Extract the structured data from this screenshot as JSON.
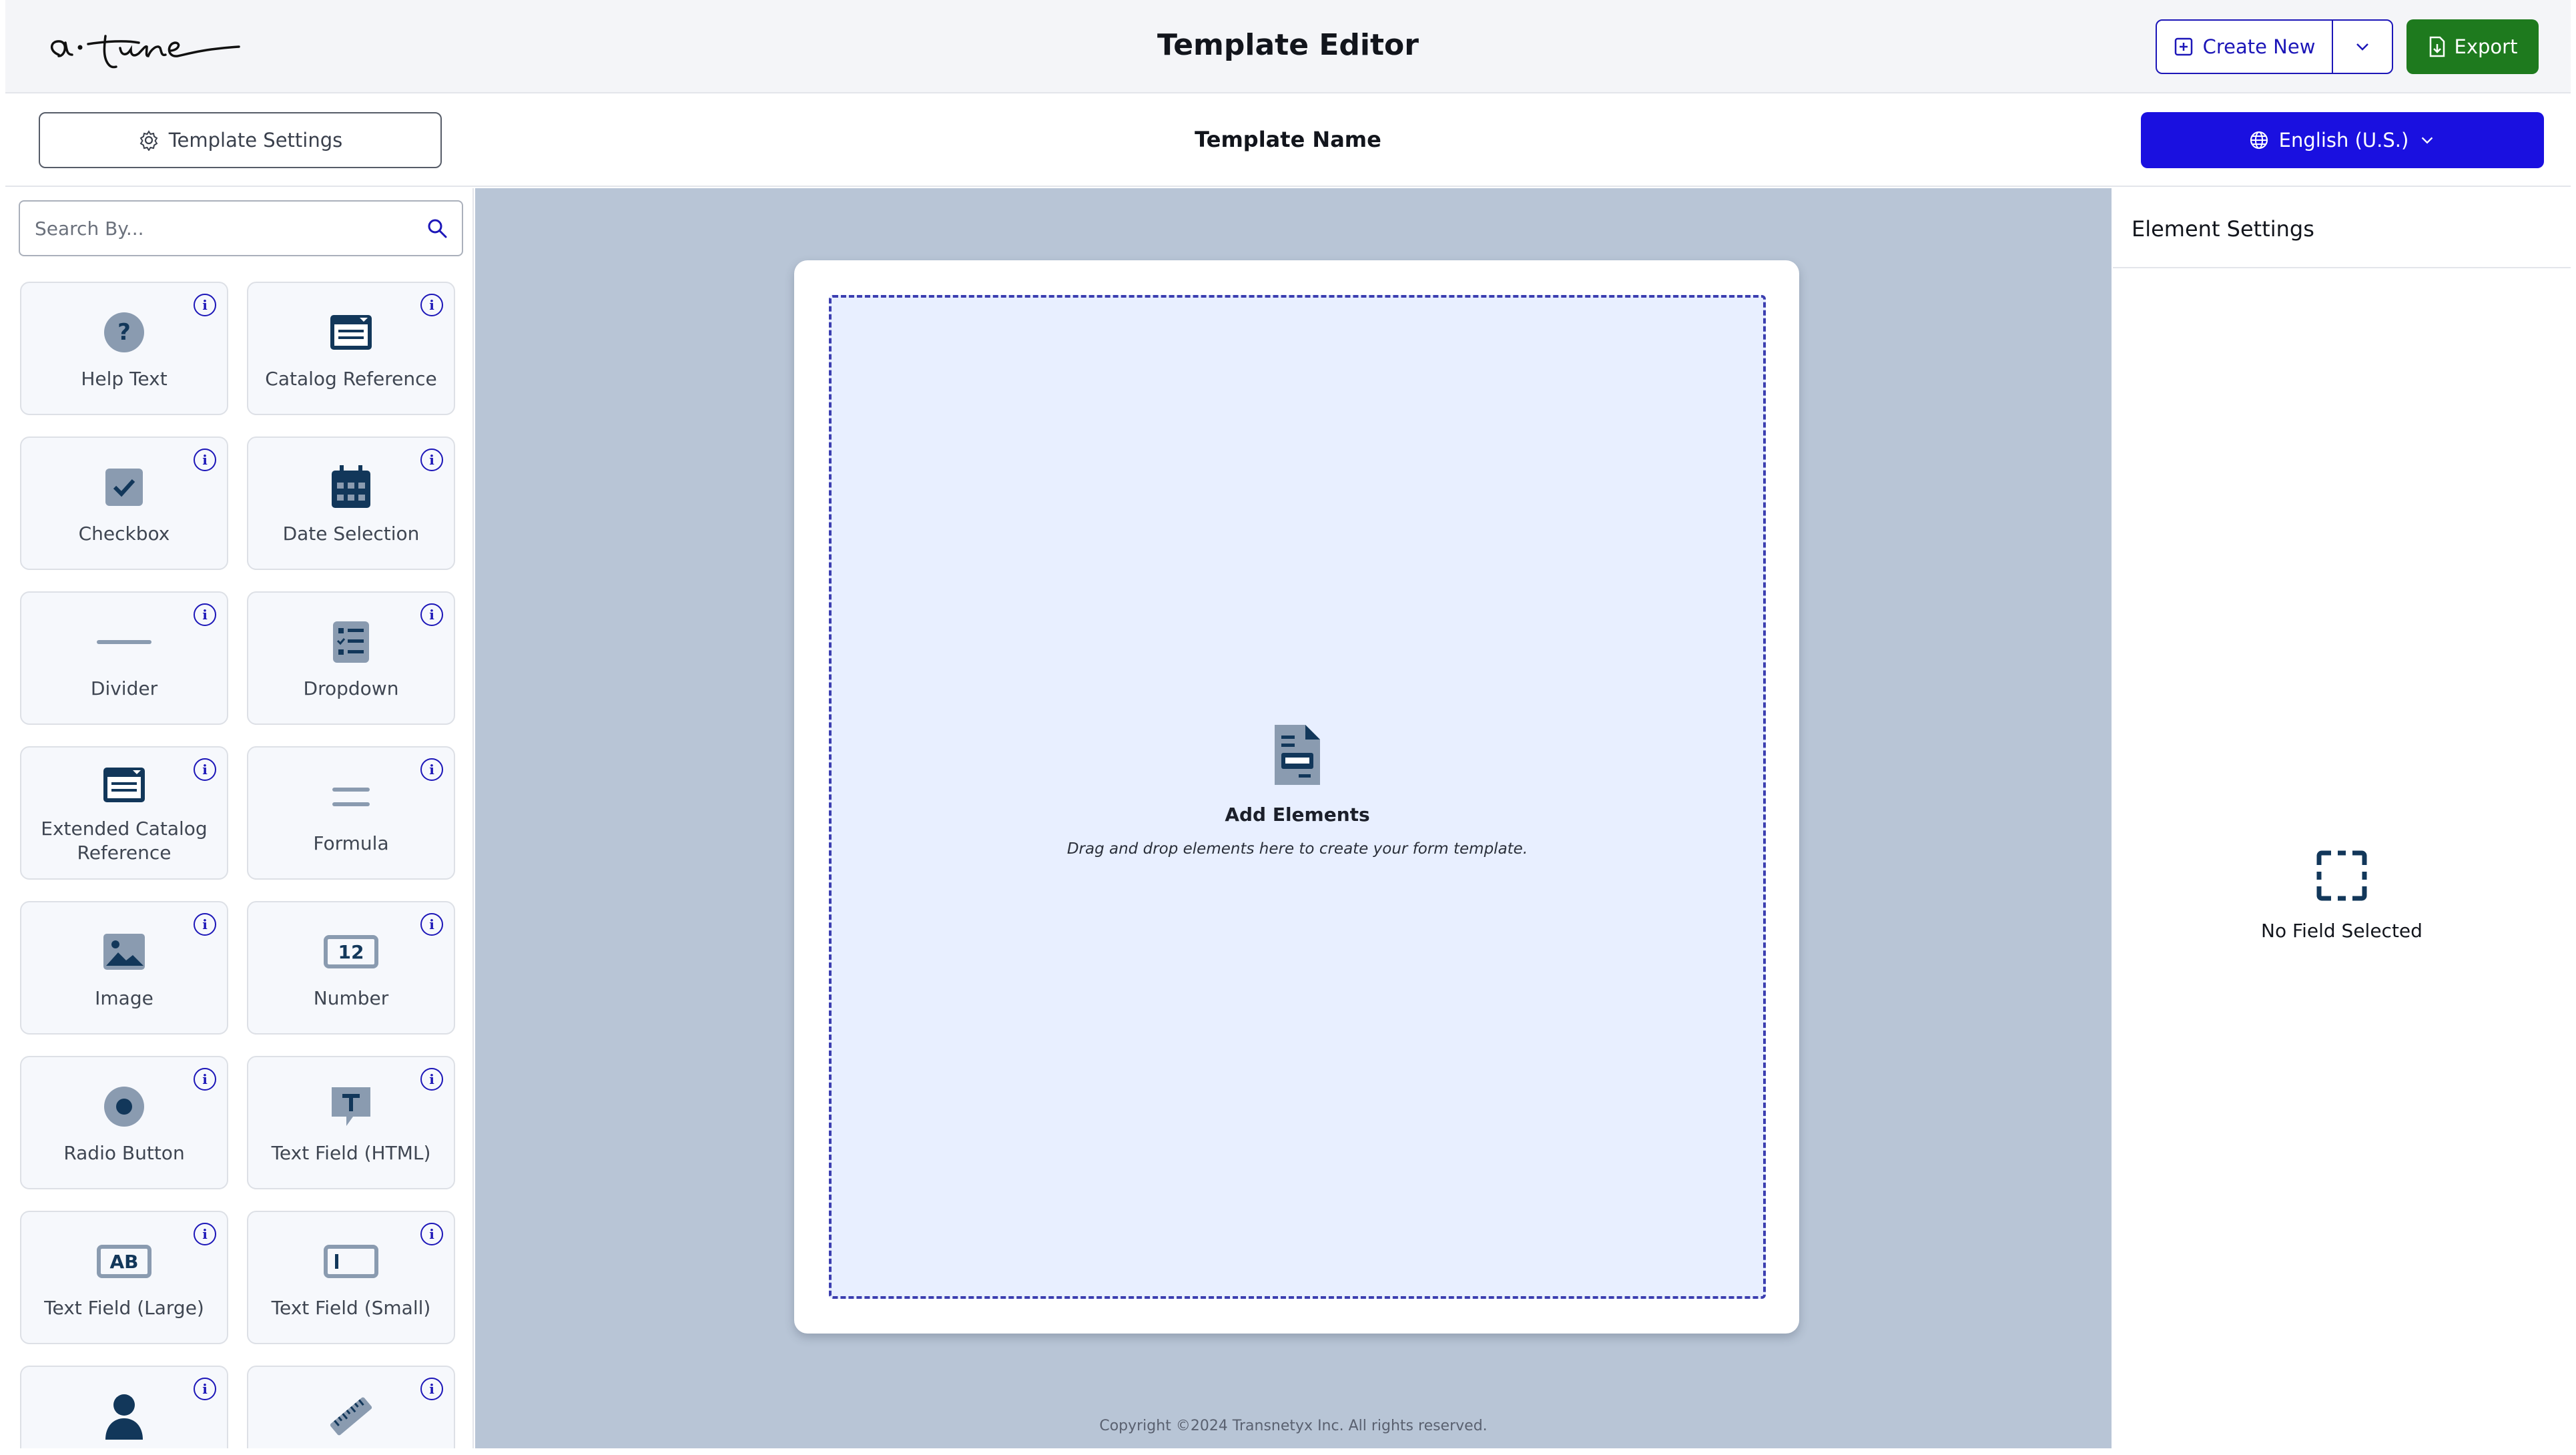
{
  "header": {
    "logo_text": "a·tune",
    "title": "Template Editor",
    "create_new_label": "Create New",
    "export_label": "Export"
  },
  "subheader": {
    "template_settings_label": "Template Settings",
    "template_name": "Template Name",
    "language_label": "English (U.S.)"
  },
  "sidebar": {
    "search_placeholder": "Search By...",
    "elements": [
      {
        "label": "Help Text",
        "icon": "help-circle-icon"
      },
      {
        "label": "Catalog Reference",
        "icon": "catalog-icon"
      },
      {
        "label": "Checkbox",
        "icon": "checkbox-icon"
      },
      {
        "label": "Date Selection",
        "icon": "calendar-icon"
      },
      {
        "label": "Divider",
        "icon": "divider-icon"
      },
      {
        "label": "Dropdown",
        "icon": "list-icon"
      },
      {
        "label": "Extended Catalog Reference",
        "icon": "catalog-icon"
      },
      {
        "label": "Formula",
        "icon": "equals-icon"
      },
      {
        "label": "Image",
        "icon": "image-icon"
      },
      {
        "label": "Number",
        "icon": "number-icon"
      },
      {
        "label": "Radio Button",
        "icon": "radio-icon"
      },
      {
        "label": "Text Field (HTML)",
        "icon": "text-bubble-icon"
      },
      {
        "label": "Text Field (Large)",
        "icon": "text-large-icon"
      },
      {
        "label": "Text Field (Small)",
        "icon": "text-small-icon"
      },
      {
        "label": "",
        "icon": "user-icon"
      },
      {
        "label": "",
        "icon": "ruler-icon"
      }
    ]
  },
  "canvas": {
    "empty_title": "Add Elements",
    "empty_subtitle": "Drag and drop elements here to create your form template.",
    "copyright": "Copyright ©2024 Transnetyx Inc. All rights reserved."
  },
  "element_settings": {
    "title": "Element Settings",
    "empty_text": "No Field Selected"
  },
  "colors": {
    "primary_blue": "#1a10e0",
    "export_green": "#1e7a1e",
    "canvas_bg": "#b8c5d6",
    "icon_dark": "#12375a",
    "icon_gray": "#8a9bb0"
  }
}
